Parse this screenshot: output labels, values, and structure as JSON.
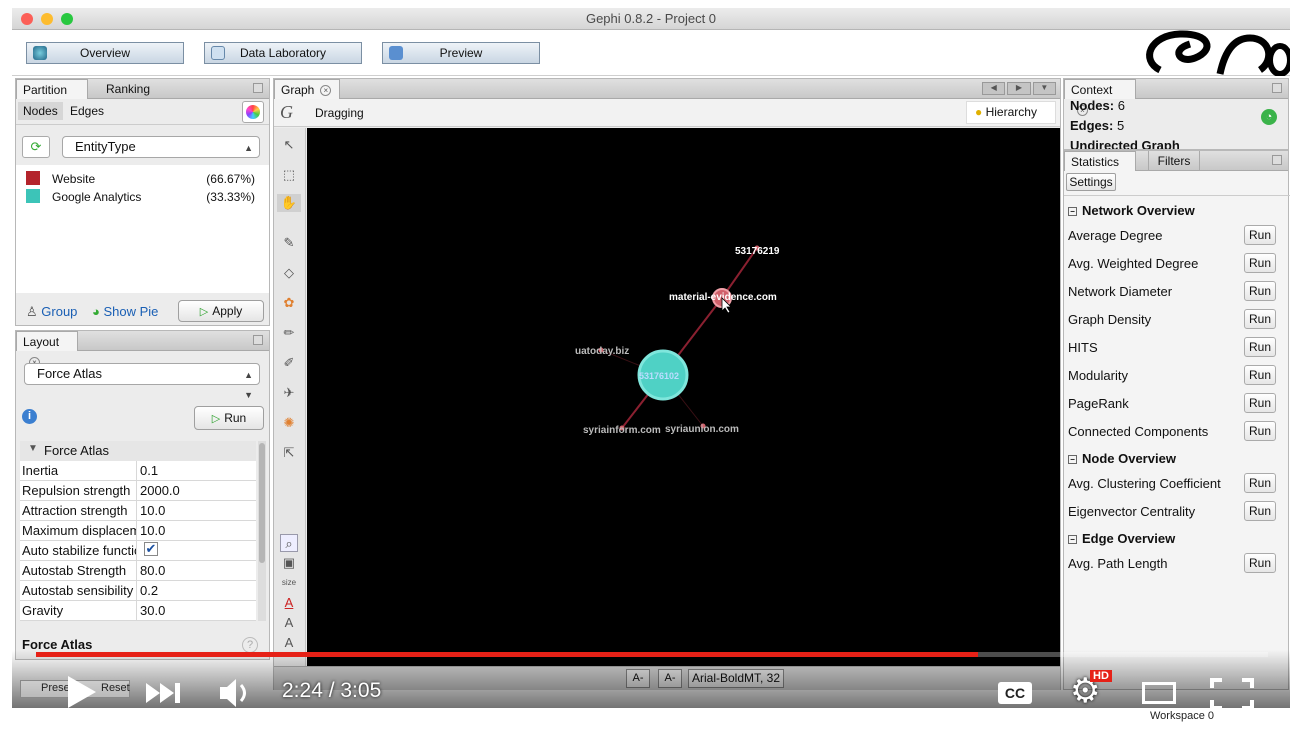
{
  "window": {
    "title": "Gephi 0.8.2 - Project 0"
  },
  "toolbar": {
    "overview": "Overview",
    "data_lab": "Data Laboratory",
    "preview": "Preview"
  },
  "partition": {
    "tabs": [
      "Partition",
      "Ranking"
    ],
    "subtabs": [
      "Nodes",
      "Edges"
    ],
    "attribute": "EntityType",
    "items": [
      {
        "label": "Website",
        "pct": "(66.67%)",
        "color": "#b4242c"
      },
      {
        "label": "Google Analytics",
        "pct": "(33.33%)",
        "color": "#3cc4b8"
      }
    ],
    "group": "Group",
    "show_pie": "Show Pie",
    "apply": "Apply"
  },
  "layout": {
    "tab": "Layout",
    "algorithm": "Force Atlas",
    "run": "Run",
    "section": "Force Atlas",
    "props": [
      {
        "name": "Inertia",
        "value": "0.1"
      },
      {
        "name": "Repulsion strength",
        "value": "2000.0"
      },
      {
        "name": "Attraction strength",
        "value": "10.0"
      },
      {
        "name": "Maximum displacement",
        "value": "10.0"
      },
      {
        "name": "Auto stabilize function",
        "value": ""
      },
      {
        "name": "Autostab Strength",
        "value": "80.0"
      },
      {
        "name": "Autostab sensibility",
        "value": "0.2"
      },
      {
        "name": "Gravity",
        "value": "30.0"
      }
    ],
    "footer": "Force Atlas",
    "presets": "Presets",
    "reset": "Reset"
  },
  "graph": {
    "tab": "Graph",
    "mode": "Dragging",
    "hierarchy": "Hierarchy",
    "nodes": [
      {
        "label": "53176219"
      },
      {
        "label": "material-evidence.com"
      },
      {
        "label": "uatoday.biz"
      },
      {
        "label": "53176102"
      },
      {
        "label": "syriainform.com"
      },
      {
        "label": "syriaunion.com"
      }
    ],
    "font": "Arial-BoldMT, 32",
    "node_colors": {
      "website": "#d0606a",
      "analytics": "#4fd1c5",
      "edge": "#8a2030"
    }
  },
  "context": {
    "tab": "Context",
    "nodes_label": "Nodes:",
    "nodes": "6",
    "edges_label": "Edges:",
    "edges": "5",
    "graph_type": "Undirected Graph"
  },
  "statistics": {
    "tabs": [
      "Statistics",
      "Filters"
    ],
    "settings": "Settings",
    "run_label": "Run",
    "sections": [
      {
        "title": "Network Overview",
        "items": [
          "Average Degree",
          "Avg. Weighted Degree",
          "Network Diameter",
          "Graph Density",
          "HITS",
          "Modularity",
          "PageRank",
          "Connected Components"
        ]
      },
      {
        "title": "Node Overview",
        "items": [
          "Avg. Clustering Coefficient",
          "Eigenvector Centrality"
        ]
      },
      {
        "title": "Edge Overview",
        "items": [
          "Avg. Path Length"
        ]
      }
    ]
  },
  "workspace": "Workspace 0",
  "video": {
    "time": "2:24 / 3:05",
    "progress": 0.765,
    "cc": "CC",
    "hd": "HD"
  }
}
